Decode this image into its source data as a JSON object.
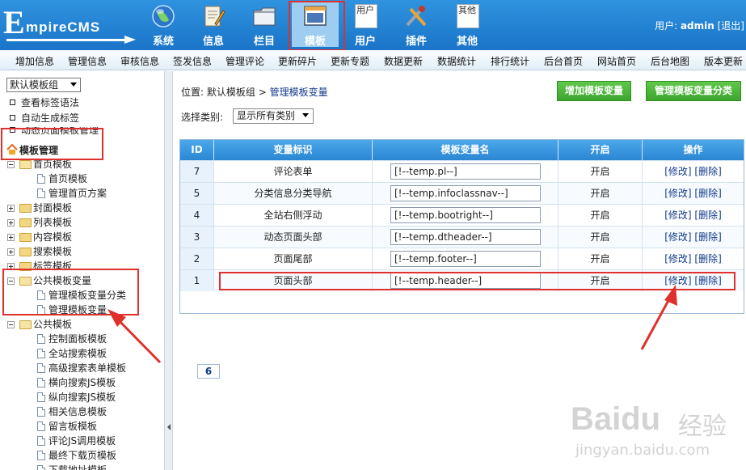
{
  "header": {
    "logo_text": "EmpireCMS",
    "nav": [
      {
        "label": "系统",
        "icon": "globe-icon"
      },
      {
        "label": "信息",
        "icon": "document-edit-icon"
      },
      {
        "label": "栏目",
        "icon": "folder-icon"
      },
      {
        "label": "模板",
        "icon": "window-template-icon",
        "selected": true
      },
      {
        "label": "用户",
        "icon": "user-icon",
        "broken_alt": "用户"
      },
      {
        "label": "插件",
        "icon": "plugin-tools-icon"
      },
      {
        "label": "其他",
        "icon": "other-icon",
        "broken_alt": "其他"
      }
    ],
    "user_label": "用户:",
    "username": "admin",
    "logout": "[退出]"
  },
  "menubar": [
    "增加信息",
    "管理信息",
    "审核信息",
    "签发信息",
    "管理评论",
    "更新碎片",
    "更新专题",
    "数据更新",
    "数据统计",
    "排行统计",
    "后台首页",
    "网站首页",
    "后台地图",
    "版本更新"
  ],
  "sidebar": {
    "template_group": "默认模板组",
    "links": [
      "查看标签语法",
      "自动生成标签",
      "动态页面模板管理"
    ],
    "section_title": "模板管理",
    "tree": [
      {
        "label": "首页模板",
        "level": 0,
        "type": "folder-open"
      },
      {
        "label": "首页模板",
        "level": 1,
        "type": "doc"
      },
      {
        "label": "管理首页方案",
        "level": 1,
        "type": "doc"
      },
      {
        "label": "封面模板",
        "level": 0,
        "type": "folder"
      },
      {
        "label": "列表模板",
        "level": 0,
        "type": "folder"
      },
      {
        "label": "内容模板",
        "level": 0,
        "type": "folder"
      },
      {
        "label": "搜索模板",
        "level": 0,
        "type": "folder"
      },
      {
        "label": "标签模板",
        "level": 0,
        "type": "folder"
      },
      {
        "label": "公共模板变量",
        "level": 0,
        "type": "folder-open"
      },
      {
        "label": "管理模板变量分类",
        "level": 1,
        "type": "doc"
      },
      {
        "label": "管理模板变量",
        "level": 1,
        "type": "doc"
      },
      {
        "label": "公共模板",
        "level": 0,
        "type": "folder-open"
      },
      {
        "label": "控制面板模板",
        "level": 1,
        "type": "doc"
      },
      {
        "label": "全站搜索模板",
        "level": 1,
        "type": "doc"
      },
      {
        "label": "高级搜索表单模板",
        "level": 1,
        "type": "doc"
      },
      {
        "label": "横向搜索JS模板",
        "level": 1,
        "type": "doc"
      },
      {
        "label": "纵向搜索JS模板",
        "level": 1,
        "type": "doc"
      },
      {
        "label": "相关信息模板",
        "level": 1,
        "type": "doc"
      },
      {
        "label": "留言板模板",
        "level": 1,
        "type": "doc"
      },
      {
        "label": "评论JS调用模板",
        "level": 1,
        "type": "doc"
      },
      {
        "label": "最终下载页模板",
        "level": 1,
        "type": "doc"
      },
      {
        "label": "下载地址模板",
        "level": 1,
        "type": "doc"
      }
    ]
  },
  "main": {
    "breadcrumb_prefix": "位置:",
    "breadcrumb_group": "默认模板组",
    "breadcrumb_sep": ">",
    "breadcrumb_page": "管理模板变量",
    "btn_add": "增加模板变量",
    "btn_manage_class": "管理模板变量分类",
    "filter_label": "选择类别:",
    "filter_value": "显示所有类别",
    "columns": [
      "ID",
      "变量标识",
      "模板变量名",
      "开启",
      "操作"
    ],
    "rows": [
      {
        "id": "7",
        "label": "评论表单",
        "var": "[!--temp.pl--]",
        "enabled": "开启",
        "ops": "[修改] [删除]"
      },
      {
        "id": "5",
        "label": "分类信息分类导航",
        "var": "[!--temp.infoclassnav--]",
        "enabled": "开启",
        "ops": "[修改] [删除]"
      },
      {
        "id": "4",
        "label": "全站右侧浮动",
        "var": "[!--temp.bootright--]",
        "enabled": "开启",
        "ops": "[修改] [删除]"
      },
      {
        "id": "3",
        "label": "动态页面头部",
        "var": "[!--temp.dtheader--]",
        "enabled": "开启",
        "ops": "[修改] [删除]"
      },
      {
        "id": "2",
        "label": "页面尾部",
        "var": "[!--temp.footer--]",
        "enabled": "开启",
        "ops": "[修改] [删除]"
      },
      {
        "id": "1",
        "label": "页面头部",
        "var": "[!--temp.header--]",
        "enabled": "开启",
        "ops": "[修改] [删除]"
      }
    ],
    "pager": "6"
  },
  "watermark": {
    "brand": "Baidu",
    "cn": "经验",
    "site": "jingyan.baidu.com"
  },
  "colors": {
    "topbar": "#1f7fd0",
    "highlight_red": "#e0302c",
    "button_green": "#4db63a"
  }
}
